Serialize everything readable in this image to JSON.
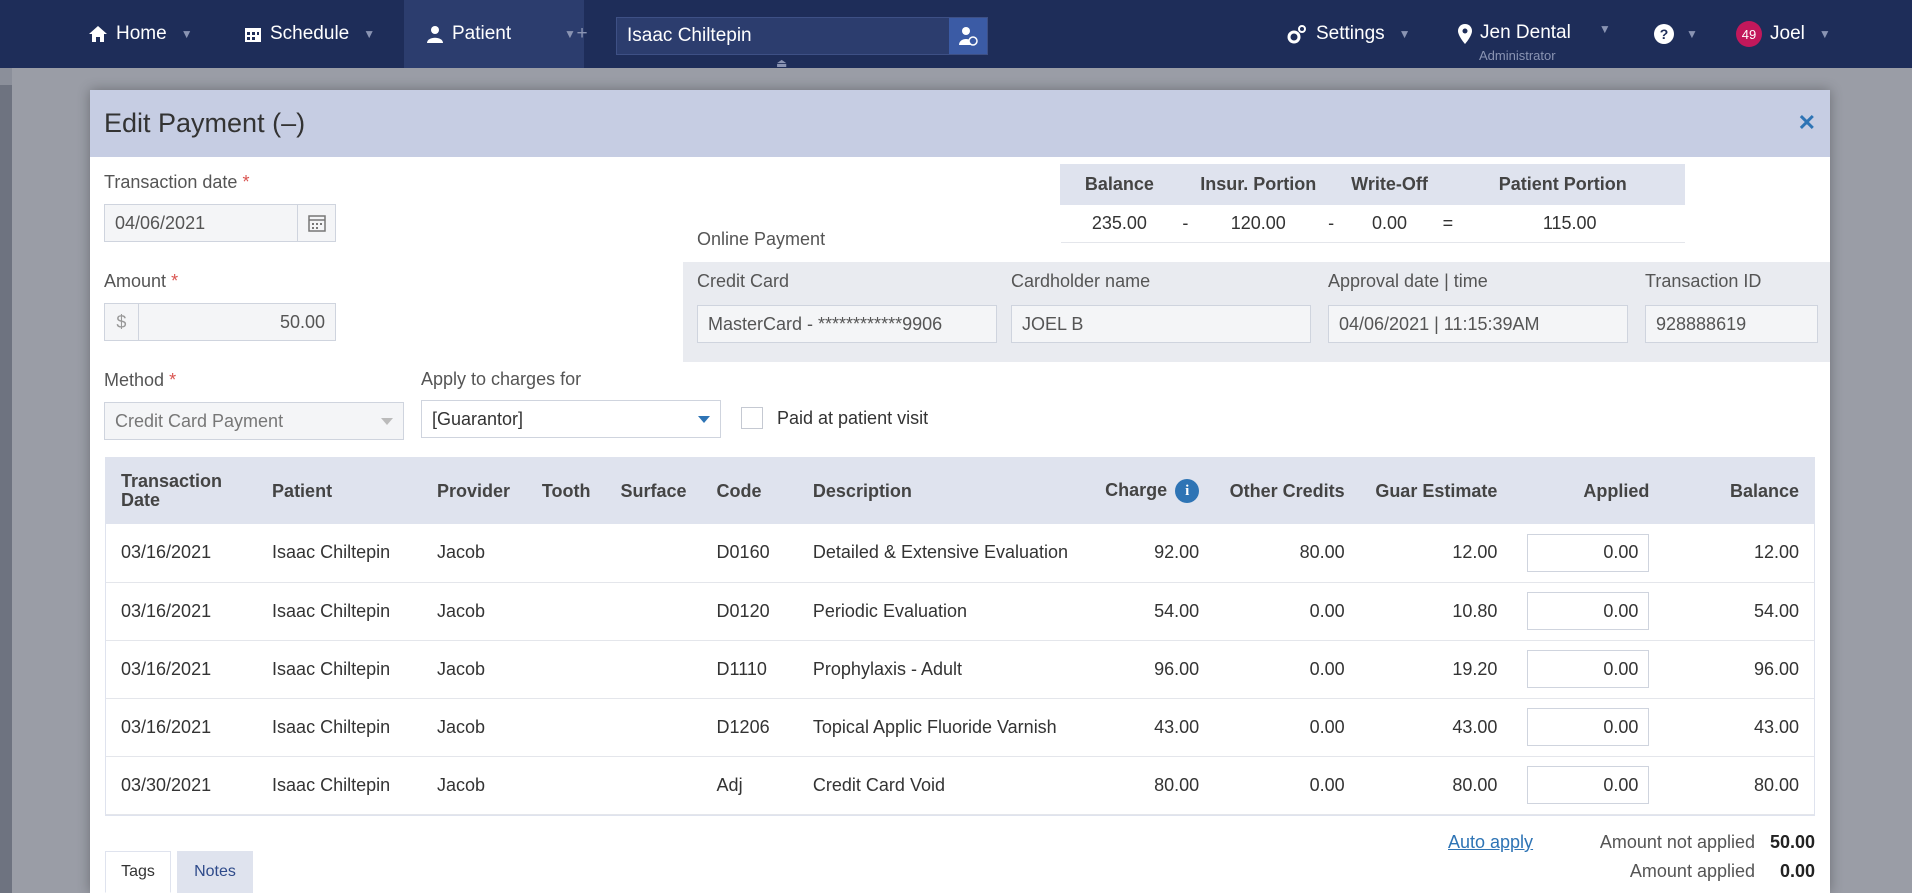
{
  "nav": {
    "home": "Home",
    "schedule": "Schedule",
    "patient": "Patient",
    "search_value": "Isaac Chiltepin",
    "settings": "Settings",
    "location": "Jen Dental",
    "role": "Administrator",
    "notification_count": "49",
    "user": "Joel"
  },
  "modal": {
    "title": "Edit Payment (–)",
    "transaction_date_label": "Transaction date",
    "transaction_date": "04/06/2021",
    "amount_label": "Amount",
    "currency": "$",
    "amount": "50.00",
    "method_label": "Method",
    "method": "Credit Card Payment",
    "apply_label": "Apply to charges for",
    "apply_value": "[Guarantor]",
    "paid_at_visit_label": "Paid at patient visit",
    "required_mark": "*"
  },
  "balance": {
    "headers": [
      "Balance",
      "Insur. Portion",
      "Write-Off",
      "Patient Portion"
    ],
    "values": [
      "235.00",
      "-",
      "120.00",
      "-",
      "0.00",
      "=",
      "115.00"
    ]
  },
  "online_payment": {
    "title": "Online Payment",
    "credit_card_label": "Credit Card",
    "credit_card": "MasterCard - ************9906",
    "cardholder_label": "Cardholder name",
    "cardholder": "JOEL B",
    "approval_label": "Approval date | time",
    "approval": "04/06/2021 | 11:15:39AM",
    "transaction_id_label": "Transaction ID",
    "transaction_id": "928888619"
  },
  "charges": {
    "headers": [
      "Transaction Date",
      "Patient",
      "Provider",
      "Tooth",
      "Surface",
      "Code",
      "Description",
      "Charge",
      "Other Credits",
      "Guar Estimate",
      "Applied",
      "Balance"
    ],
    "rows": [
      {
        "date": "03/16/2021",
        "patient": "Isaac Chiltepin",
        "provider": "Jacob",
        "tooth": "",
        "surface": "",
        "code": "D0160",
        "description": "Detailed & Extensive Evaluation",
        "charge": "92.00",
        "other_credits": "80.00",
        "guar_estimate": "12.00",
        "applied": "0.00",
        "balance": "12.00"
      },
      {
        "date": "03/16/2021",
        "patient": "Isaac Chiltepin",
        "provider": "Jacob",
        "tooth": "",
        "surface": "",
        "code": "D0120",
        "description": "Periodic Evaluation",
        "charge": "54.00",
        "other_credits": "0.00",
        "guar_estimate": "10.80",
        "applied": "0.00",
        "balance": "54.00"
      },
      {
        "date": "03/16/2021",
        "patient": "Isaac Chiltepin",
        "provider": "Jacob",
        "tooth": "",
        "surface": "",
        "code": "D1110",
        "description": "Prophylaxis - Adult",
        "charge": "96.00",
        "other_credits": "0.00",
        "guar_estimate": "19.20",
        "applied": "0.00",
        "balance": "96.00"
      },
      {
        "date": "03/16/2021",
        "patient": "Isaac Chiltepin",
        "provider": "Jacob",
        "tooth": "",
        "surface": "",
        "code": "D1206",
        "description": "Topical Applic Fluoride Varnish",
        "charge": "43.00",
        "other_credits": "0.00",
        "guar_estimate": "43.00",
        "applied": "0.00",
        "balance": "43.00"
      },
      {
        "date": "03/30/2021",
        "patient": "Isaac Chiltepin",
        "provider": "Jacob",
        "tooth": "",
        "surface": "",
        "code": "Adj",
        "description": "Credit Card Void",
        "charge": "80.00",
        "other_credits": "0.00",
        "guar_estimate": "80.00",
        "applied": "0.00",
        "balance": "80.00"
      }
    ]
  },
  "footer": {
    "auto_apply": "Auto apply",
    "not_applied_label": "Amount not applied",
    "not_applied": "50.00",
    "applied_label": "Amount applied",
    "applied": "0.00",
    "tabs": [
      "Tags",
      "Notes"
    ]
  }
}
